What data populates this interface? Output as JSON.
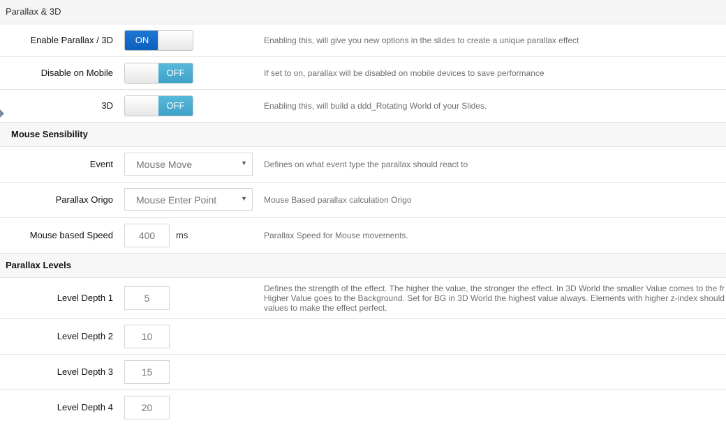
{
  "section": {
    "title": "Parallax & 3D"
  },
  "rows_main": [
    {
      "label": "Enable Parallax / 3D",
      "toggle_text": "ON",
      "state": "on",
      "description": "Enabling this, will give you new options in the slides to create a unique parallax effect"
    },
    {
      "label": "Disable on Mobile",
      "toggle_text": "OFF",
      "state": "off",
      "description": "If set to on, parallax will be disabled on mobile devices to save performance"
    },
    {
      "label": "3D",
      "toggle_text": "OFF",
      "state": "off",
      "description": "Enabling this, will build a ddd_Rotating World of your Slides."
    }
  ],
  "mouse": {
    "heading": "Mouse Sensibility",
    "event": {
      "label": "Event",
      "value": "Mouse Move",
      "description": "Defines on what event type the parallax should react to"
    },
    "origo": {
      "label": "Parallax Origo",
      "value": "Mouse Enter Point",
      "description": "Mouse Based parallax calculation Origo"
    },
    "speed": {
      "label": "Mouse based Speed",
      "value": "400",
      "unit": "ms",
      "description": "Parallax Speed for Mouse movements."
    }
  },
  "levels": {
    "heading": "Parallax Levels",
    "description_lines": [
      "Defines the strength of the effect. The higher the value, the stronger the effect. In 3D World the smaller Value comes to the fr",
      "Higher Value goes to the Background. Set for BG in 3D World the highest value always. Elements with higher z-index should",
      "values to make the effect perfect."
    ],
    "items": [
      {
        "label": "Level Depth 1",
        "value": "5"
      },
      {
        "label": "Level Depth 2",
        "value": "10"
      },
      {
        "label": "Level Depth 3",
        "value": "15"
      },
      {
        "label": "Level Depth 4",
        "value": "20"
      }
    ]
  },
  "icons": {
    "dropdown": "chevron-down-icon",
    "section_marker": "caret-right-icon"
  },
  "colors": {
    "on": "#0b5fbf",
    "off": "#3ea2c7"
  }
}
